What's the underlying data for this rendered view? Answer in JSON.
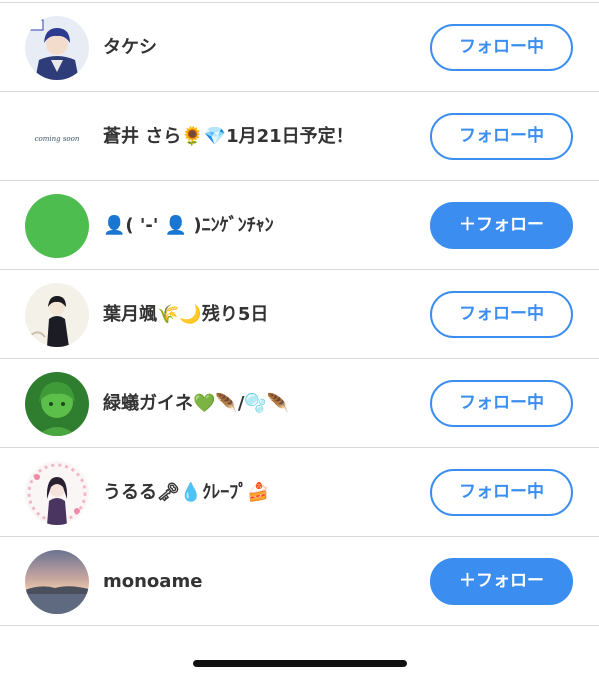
{
  "users": [
    {
      "name": "タケシ",
      "button": "フォロー中",
      "state": "following",
      "avatar": "anime-boy-avatar"
    },
    {
      "name": "蒼井 さら🌻💎1月21日予定！",
      "button": "フォロー中",
      "state": "following",
      "avatar": "coming-soon-avatar",
      "avatar_text": "coming soon"
    },
    {
      "name": "👤( '-' 👤 )ﾆﾝｹﾞﾝﾁｬﾝ",
      "button": "＋フォロー",
      "state": "follow",
      "avatar": "green-circle-avatar"
    },
    {
      "name": "葉月颯🌾🌙残り5日",
      "button": "フォロー中",
      "state": "following",
      "avatar": "dark-figure-avatar"
    },
    {
      "name": "緑蟻ガイネ💚🪶/🫧🪶",
      "button": "フォロー中",
      "state": "following",
      "avatar": "green-character-avatar"
    },
    {
      "name": "うるる🗝💧ｸﾚｰﾌﾟ🍰",
      "button": "フォロー中",
      "state": "following",
      "avatar": "anime-girl-avatar"
    },
    {
      "name": "monoame",
      "button": "＋フォロー",
      "state": "follow",
      "avatar": "sunset-landscape-avatar"
    }
  ],
  "colors": {
    "accent": "#3b8ef0",
    "text": "#333333",
    "divider": "#d9d9d9"
  }
}
